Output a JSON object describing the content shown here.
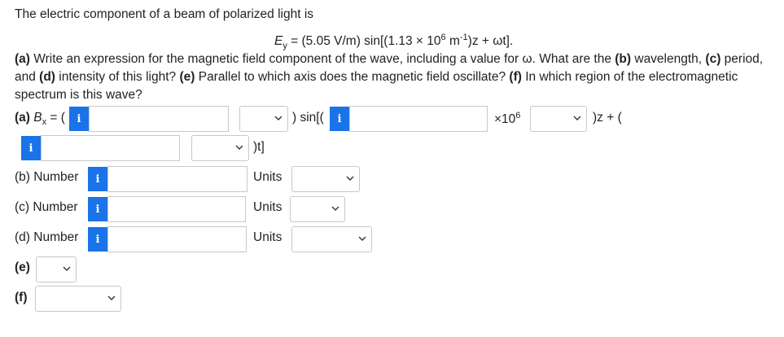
{
  "intro": "The electric component of a beam of polarized light is",
  "equation": {
    "lhs_var": "E",
    "lhs_sub": "y",
    "rhs": " = (5.05 V/m) sin[(1.13 × 10",
    "exp": "6",
    "unit": " m",
    "unit_exp": "-1",
    "tail": ")z + ωt]."
  },
  "question": {
    "p1_bold": "(a)",
    "p1": " Write an expression for the magnetic field component of the wave, including a value for ω. What are the ",
    "p2_bold": "(b)",
    "p2": " wavelength, ",
    "p3_bold": "(c)",
    "p3": " period,",
    "line2_bold": "(d)",
    "line2a": " intensity of this light? ",
    "line2_bold2": "(e)",
    "line2b": " Parallel to which axis does the magnetic field oscillate? ",
    "line2_bold3": "(f)",
    "line2c": " In which region of the electromagnetic",
    "line2_pre": "and ",
    "line3": "spectrum is this wave?"
  },
  "row_a": {
    "label_bold": "(a)",
    "label_var": " B",
    "label_sub": "x",
    "label_tail": " = (",
    "sin_text": ") sin[(",
    "times_text": "×10",
    "times_exp": "6",
    "z_text": ")z + (",
    "t_text": ")t]"
  },
  "row_b": {
    "label": "(b) Number",
    "units": "Units"
  },
  "row_c": {
    "label": "(c) Number",
    "units": "Units"
  },
  "row_d": {
    "label": "(d) Number",
    "units": "Units"
  },
  "row_e": {
    "label": "(e)"
  },
  "row_f": {
    "label": "(f)"
  },
  "info_glyph": "i",
  "colors": {
    "info_button": "#1a73e8",
    "border": "#c8c8c8"
  }
}
